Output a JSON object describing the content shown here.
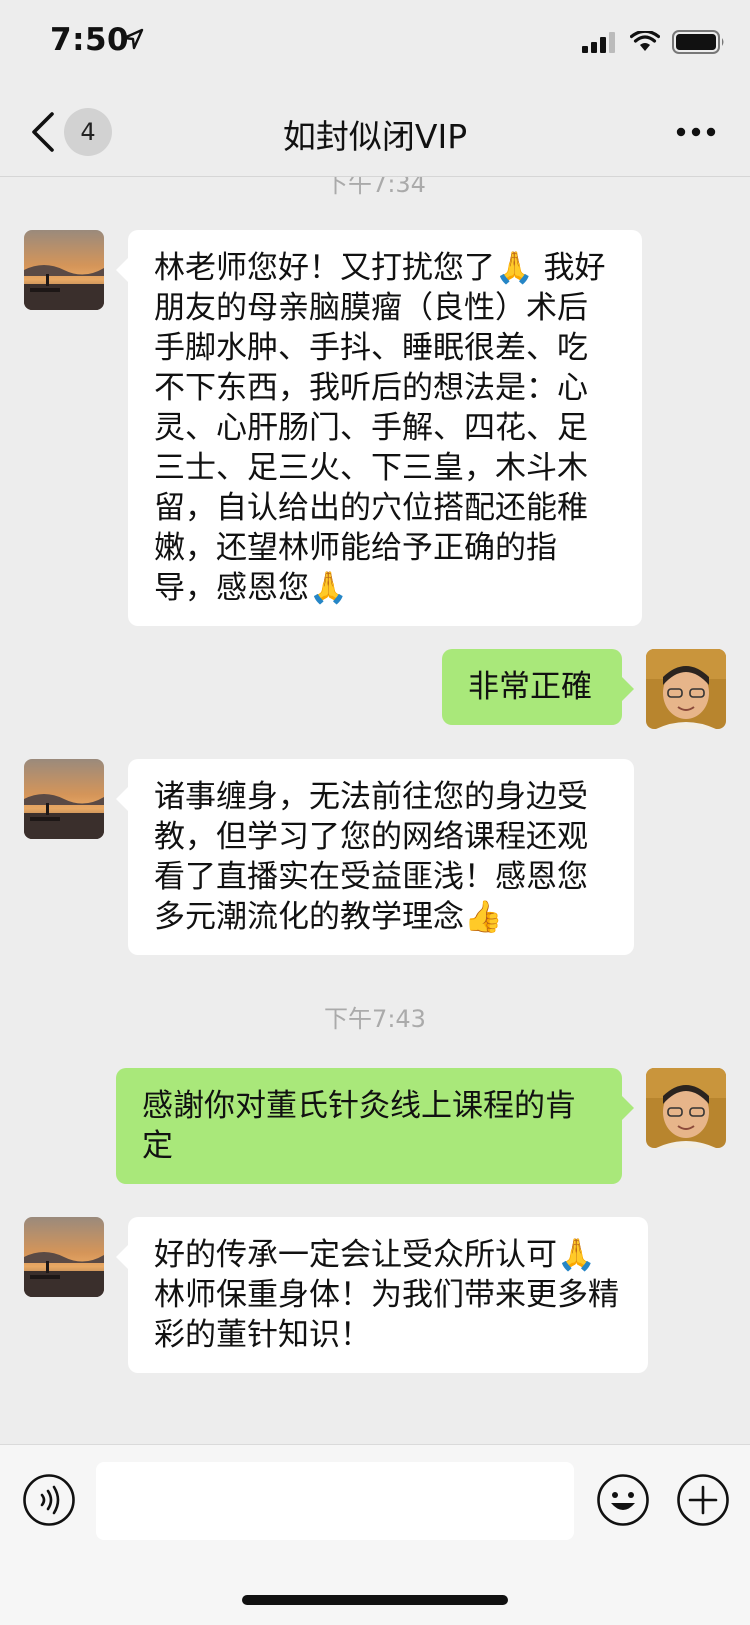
{
  "status_bar": {
    "time": "7:50"
  },
  "nav": {
    "back_count": "4",
    "title": "如封似闭VIP"
  },
  "chat": {
    "time_1": "下午7:34",
    "msg_1": "林老师您好！又打扰您了🙏 我好朋友的母亲脑膜瘤（良性）术后 手脚水肿、手抖、睡眠很差、吃不下东西，我听后的想法是：心灵、心肝肠门、手解、四花、足三士、足三火、下三皇，木斗木留，自认给出的穴位搭配还能稚嫩，还望林师能给予正确的指导，感恩您🙏",
    "msg_2": "非常正確",
    "msg_3": "诸事缠身，无法前往您的身边受教，但学习了您的网络课程还观看了直播实在受益匪浅！感恩您多元潮流化的教学理念👍",
    "time_2": "下午7:43",
    "msg_4": "感謝你对董氏针灸线上课程的肯定",
    "msg_5": "好的传承一定会让受众所认可🙏 林师保重身体！为我们带来更多精彩的董针知识！"
  },
  "input": {
    "placeholder": ""
  },
  "icons": {
    "location": "location-arrow-icon",
    "signal": "cellular-signal-icon",
    "wifi": "wifi-icon",
    "battery": "battery-icon",
    "back": "chevron-left-icon",
    "more": "more-dots-icon",
    "voice": "voice-input-icon",
    "emoji": "emoji-icon",
    "plus": "plus-icon"
  },
  "colors": {
    "background": "#ededed",
    "outgoing_bubble": "#a9e87a",
    "incoming_bubble": "#ffffff",
    "timestamp": "#aaaaaa"
  }
}
